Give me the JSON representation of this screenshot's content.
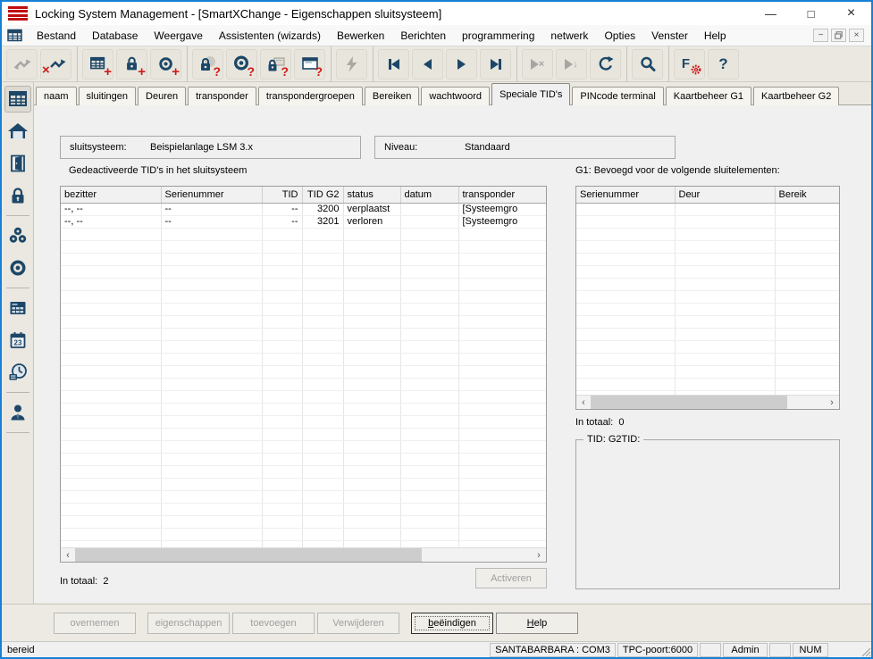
{
  "window": {
    "title": "Locking System Management - [SmartXChange - Eigenschappen sluitsysteem]",
    "controls": {
      "minimize": "—",
      "maximize": "□",
      "close": "×"
    },
    "mdi": {
      "minimize": "−",
      "close": "×"
    }
  },
  "menu": {
    "items": [
      "Bestand",
      "Database",
      "Weergave",
      "Assistenten (wizards)",
      "Bewerken",
      "Berichten",
      "programmering",
      "netwerk",
      "Opties",
      "Venster",
      "Help"
    ]
  },
  "icons": {
    "plus": "+",
    "question": "?",
    "cross": "×",
    "down_arrow": "↓",
    "filter_letter": "F",
    "help_mark": "?",
    "scroll_left": "‹",
    "scroll_right": "›"
  },
  "toolbar": {
    "buttons": [
      {
        "name": "sync-arrows",
        "enabled": false
      },
      {
        "name": "disconnect",
        "enabled": true
      },
      {
        "name": "new-locking-system",
        "enabled": true
      },
      {
        "name": "new-lock",
        "enabled": true
      },
      {
        "name": "new-transponder",
        "enabled": true
      },
      {
        "name": "read-lock",
        "enabled": true
      },
      {
        "name": "read-transponder",
        "enabled": true
      },
      {
        "name": "read-g1-lock",
        "enabled": true
      },
      {
        "name": "read-window",
        "enabled": true
      },
      {
        "name": "program",
        "enabled": false
      },
      {
        "name": "first-record",
        "enabled": true
      },
      {
        "name": "previous-record",
        "enabled": true
      },
      {
        "name": "next-record",
        "enabled": true
      },
      {
        "name": "last-record",
        "enabled": true
      },
      {
        "name": "remove-record",
        "enabled": false
      },
      {
        "name": "goto-record",
        "enabled": false
      },
      {
        "name": "refresh",
        "enabled": true
      },
      {
        "name": "search",
        "enabled": true
      },
      {
        "name": "filter-settings",
        "enabled": true
      },
      {
        "name": "help",
        "enabled": true
      }
    ]
  },
  "sidebar": {
    "items": [
      "matrix",
      "home",
      "door",
      "lock",
      "transponder-groups",
      "transponder",
      "schedule",
      "calendar",
      "time-zones",
      "user"
    ]
  },
  "tabs": {
    "items": [
      "naam",
      "sluitingen",
      "Deuren",
      "transponder",
      "transpondergroepen",
      "Bereiken",
      "wachtwoord",
      "Speciale TID's",
      "PINcode terminal",
      "Kaartbeheer G1",
      "Kaartbeheer G2"
    ],
    "active": "Speciale TID's"
  },
  "content": {
    "fields": [
      {
        "label": "sluitsysteem:",
        "value": "Beispielanlage LSM 3.x"
      },
      {
        "label": "Niveau:",
        "value": "Standaard"
      }
    ],
    "left_section": {
      "title": "Gedeactiveerde TID's in het sluitsysteem",
      "table": {
        "columns": [
          "bezitter",
          "Serienummer",
          "TID",
          "TID G2",
          "status",
          "datum",
          "transponder"
        ],
        "rows": [
          [
            "--, --",
            "--",
            "--",
            "3200",
            "verplaatst",
            "",
            "[Systeemgro"
          ],
          [
            "--, --",
            "--",
            "--",
            "3201",
            "verloren",
            "",
            "[Systeemgro"
          ]
        ]
      },
      "total_label": "In totaal:",
      "total_value": "2",
      "activate_button": "Activeren"
    },
    "right_section": {
      "title": "G1: Bevoegd voor de volgende sluitelementen:",
      "table": {
        "columns": [
          "Serienummer",
          "Deur",
          "Bereik"
        ],
        "rows": []
      },
      "total_label": "In totaal:",
      "total_value": "0",
      "groupbox_label": "TID:   G2TID:"
    }
  },
  "footer": {
    "buttons": [
      {
        "label": "overnemen",
        "enabled": false
      },
      {
        "label": "eigenschappen",
        "enabled": false
      },
      {
        "label": "toevoegen",
        "enabled": false
      },
      {
        "label": "Verwijderen",
        "enabled": false
      },
      {
        "label_mnemonic": "b",
        "label_rest": "eëindigen",
        "enabled": true,
        "default": true
      },
      {
        "label_mnemonic": "H",
        "label_rest": "elp",
        "enabled": true
      }
    ]
  },
  "statusbar": {
    "left": "bereid",
    "segments": [
      "SANTABARBARA : COM3",
      "TPC-poort:6000",
      "",
      "Admin",
      "",
      "NUM",
      ""
    ]
  }
}
